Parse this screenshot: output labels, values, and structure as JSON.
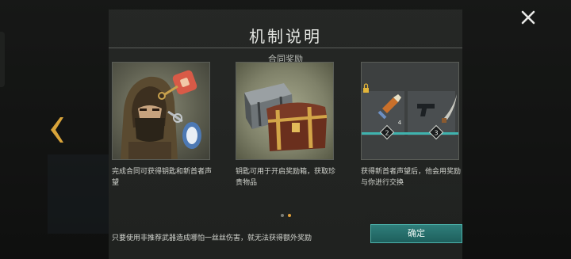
{
  "modal": {
    "title": "机制说明",
    "subtitle": "合同奖励",
    "cards": [
      {
        "description": "完成合同可获得钥匙和新首者声望",
        "icons": [
          "hooded-character",
          "key-icon",
          "key-tag-icon"
        ]
      },
      {
        "description": "钥匙可用于开启奖励箱，获取珍贵物品",
        "icons": [
          "silver-chest",
          "gold-chest"
        ]
      },
      {
        "description": "获得新首者声望后，他会用奖励与你进行交换",
        "icons": [
          "lock-icon",
          "ammo-icon",
          "pistol-icon",
          "blade-icon"
        ],
        "badges": [
          "4",
          "2",
          "3"
        ]
      }
    ],
    "pager": {
      "count": 2,
      "active_index": 1
    },
    "footer_note": "只要使用非推荐武器造成哪怕一丝丝伤害，就无法获得额外奖励",
    "confirm_label": "确定"
  },
  "colors": {
    "accent_teal": "#2f7f7b",
    "accent_gold": "#e3a13a",
    "arrow_gold": "#d9a43a"
  }
}
